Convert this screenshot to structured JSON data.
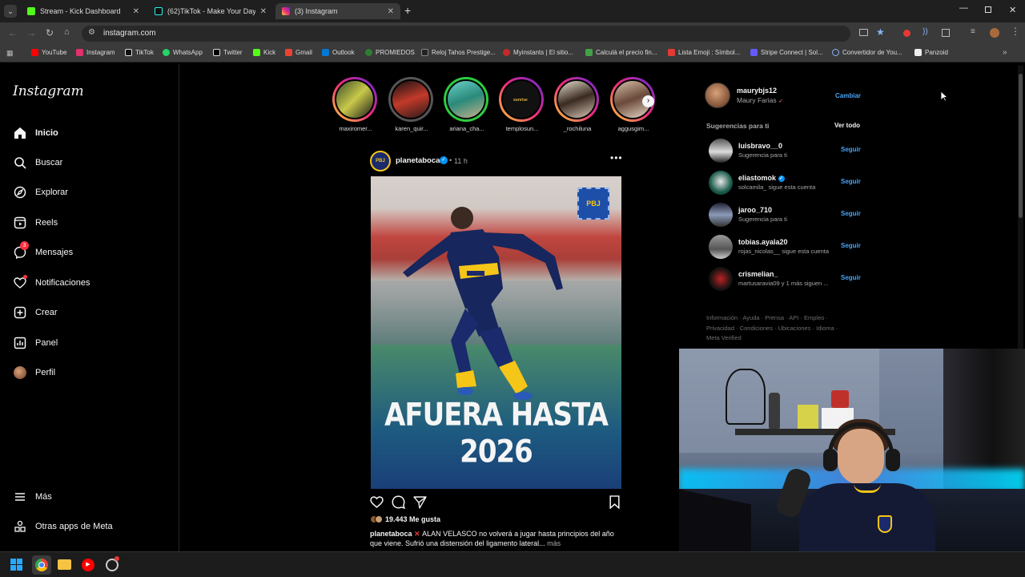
{
  "tabs": [
    {
      "title": "Stream - Kick Dashboard",
      "color": "#53fc18"
    },
    {
      "title": "(62)TikTok - Make Your Day",
      "color": "#111111"
    },
    {
      "title": "(3) Instagram",
      "color": "#e1306c"
    }
  ],
  "address": {
    "url": "instagram.com"
  },
  "bookmarks": [
    "YouTube",
    "Instagram",
    "TikTok",
    "WhatsApp",
    "Twitter",
    "Kick",
    "Gmail",
    "Outlook",
    "PROMIEDOS",
    "Reloj Tahos Prestige...",
    "Myinstants | El sitio...",
    "Calculá el precio fin...",
    "Lista Emoji : Símbol...",
    "Stripe Connect | Sol...",
    "Convertidor de You...",
    "Panzoid"
  ],
  "sidebar": {
    "logo": "Instagram",
    "items": [
      {
        "label": "Inicio",
        "icon": "home-icon"
      },
      {
        "label": "Buscar",
        "icon": "search-icon"
      },
      {
        "label": "Explorar",
        "icon": "compass-icon"
      },
      {
        "label": "Reels",
        "icon": "reels-icon"
      },
      {
        "label": "Mensajes",
        "icon": "messenger-icon",
        "badge": "3"
      },
      {
        "label": "Notificaciones",
        "icon": "heart-icon"
      },
      {
        "label": "Crear",
        "icon": "plus-square-icon"
      },
      {
        "label": "Panel",
        "icon": "chart-icon"
      },
      {
        "label": "Perfil",
        "icon": "avatar-icon"
      }
    ],
    "more": "Más",
    "meta_apps": "Otras apps de Meta"
  },
  "stories": [
    "maxiromer...",
    "karen_quir...",
    "ariana_cha...",
    "templosun...",
    "_rochiluna",
    "aggusgim..."
  ],
  "post": {
    "username": "planetaboca",
    "time": "11 h",
    "headline_1": "AFUERA HASTA",
    "headline_2": "2026",
    "badge_text": "PBJ",
    "likes": "19.443 Me gusta",
    "caption_user": "planetaboca",
    "caption_text": "ALAN VELASCO no volverá a jugar hasta principios del año que viene. Sufrió una distensión del ligamento lateral...",
    "more": "más"
  },
  "account": {
    "username": "maurybjs12",
    "name": "Maury Farias",
    "switch": "Cambiar"
  },
  "suggestions": {
    "title": "Sugerencias para ti",
    "see_all": "Ver todo",
    "follow_label": "Seguir",
    "items": [
      {
        "username": "luisbravo__0",
        "sub": "Sugerencia para ti"
      },
      {
        "username": "eliastomok",
        "sub": "solcamila_ sigue esta cuenta"
      },
      {
        "username": "jaroo_710",
        "sub": "Sugerencia para ti"
      },
      {
        "username": "tobias.ayala20",
        "sub": "rojas_nicolas__ sigue esta cuenta"
      },
      {
        "username": "crismelian_",
        "sub": "martusaravia09 y 1 más siguen ..."
      }
    ]
  },
  "footer": {
    "line1": "Información · Ayuda · Prensa · API · Empleo ·",
    "line2": "Privacidad · Condiciones · Ubicaciones · Idioma ·",
    "line3": "Meta Verified"
  },
  "colors": {
    "accent": "#4aa3f5",
    "ig_bg": "#000000",
    "boca_blue": "#1a2a6c",
    "boca_gold": "#f5c518"
  }
}
